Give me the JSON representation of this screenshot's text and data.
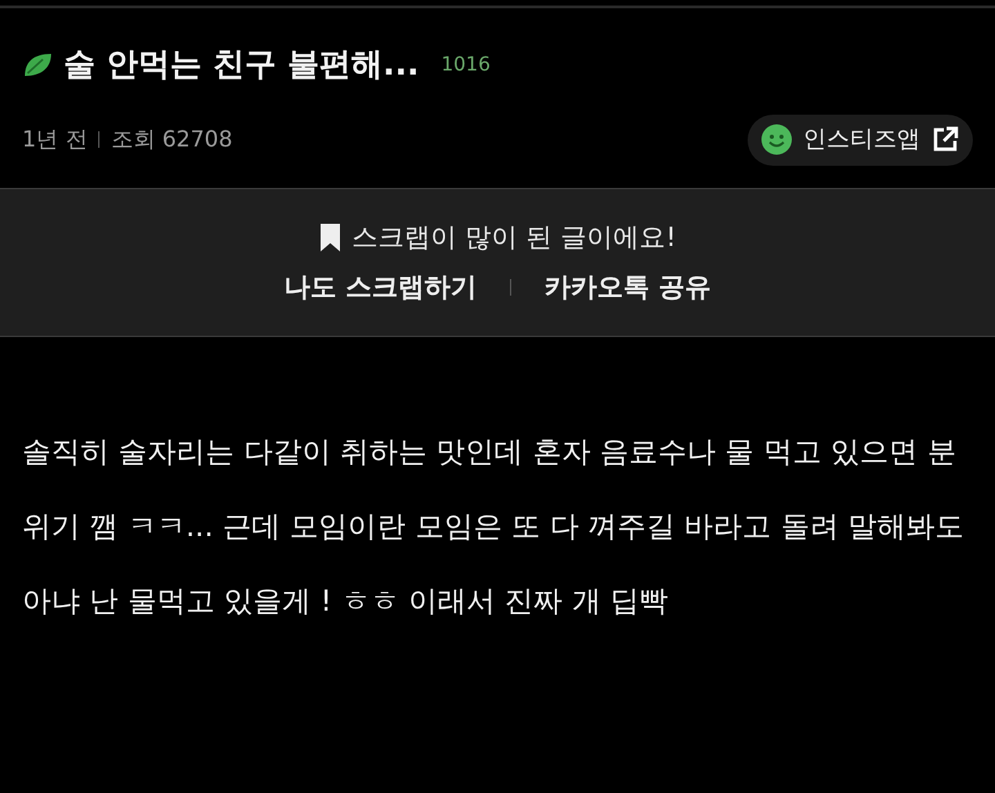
{
  "post": {
    "title": "술 안먹는 친구 불편해...",
    "comment_count": "1016",
    "time": "1년 전",
    "views": "조회 62708",
    "app_button": "인스티즈앱"
  },
  "scrap_banner": {
    "message": "스크랩이 많이 된 글이에요!",
    "actions": [
      "나도 스크랩하기",
      "카카오톡 공유"
    ]
  },
  "body": "솔직히 술자리는 다같이 취하는 맛인데 혼자 음료수나 물 먹고 있으면 분위기 깸 ㅋㅋ... 근데 모임이란 모임은 또 다 껴주길 바라고 돌려 말해봐도 아냐 난 물먹고 있을게 ! ㅎㅎ 이래서 진짜 개 딥빡"
}
